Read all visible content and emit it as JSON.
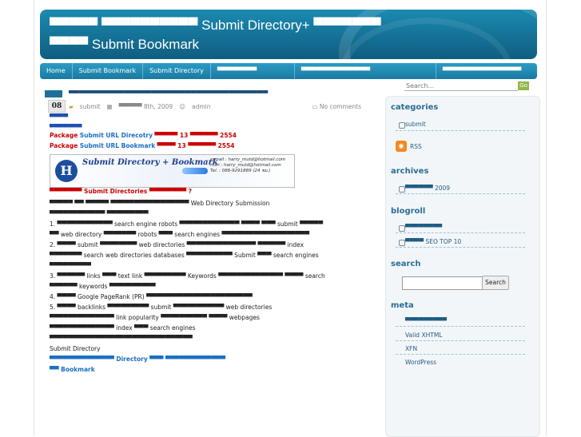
{
  "header": {
    "title_line1": "▀▀▀▀▀ ▀▀▀▀▀▀▀▀▀▀ Submit Directory+ ▀▀▀▀▀▀▀",
    "title_line2": "▀▀▀▀ Submit Bookmark"
  },
  "nav": {
    "items": [
      "Home",
      "Submit Bookmark",
      "Submit Directory",
      "▀▀▀▀▀▀▀▀",
      "▀▀▀▀▀▀▀▀▀▀▀▀▀▀",
      "▀▀▀▀▀▀▀▀▀▀▀▀▀▀▀▀"
    ]
  },
  "search": {
    "placeholder": "Search...",
    "go_label": "Go"
  },
  "post": {
    "date_day": "08",
    "title": "▀▀▀▀▀▀▀▀▀▀▀▀▀▀▀▀▀▀▀▀▀▀▀▀▀▀▀▀▀▀▀▀▀▀▀▀",
    "category": "submit",
    "date_text": "▀▀▀▀▀ 8th, 2009",
    "author": "admin",
    "comments": "No comments",
    "line_a": "▀▀▀▀",
    "line_b": "▀▀▀▀▀▀▀",
    "pkg1_a": "Package",
    "pkg1_b": "Submit URL Direcotry",
    "pkg1_c": "▀▀▀▀▀ 13 ▀▀▀▀▀▀ 2554",
    "pkg2_a": "Package",
    "pkg2_b": "Submit URL Bookmark",
    "pkg2_c": "▀▀▀▀ 13 ▀▀▀▀▀▀ 2554",
    "banner_logo": "H",
    "banner_title": "Submit Directory + Bookmark",
    "banner_contact_1": "e-mail : harry_mutd@hotmail.com",
    "banner_contact_2": "msn : harry_mutd@hotmail.com",
    "banner_contact_3": "Tel. : 086-9291889 (24 ชม.)",
    "after_banner": "▀▀▀▀▀▀▀ Submit Directories ▀▀▀▀▀▀▀▀ ?",
    "p1": "▀▀▀▀▀ ▀▀ ▀▀▀▀▀ ▀▀▀▀▀▀▀▀▀▀▀▀▀▀▀▀▀ Web Directory Submission ▀▀▀▀▀▀▀▀▀▀▀▀ ▀▀▀▀▀▀▀▀▀",
    "p2": "1. ▀▀▀▀▀▀▀▀▀▀▀▀ search engine robots ▀▀▀▀▀▀▀▀▀▀▀▀▀ ▀▀▀▀ ▀▀▀ submit ▀▀▀▀▀ ▀▀ web directory ▀▀▀▀▀▀▀ robots ▀▀▀ search engines ▀▀▀▀▀▀▀▀▀▀▀▀▀▀▀▀▀▀▀",
    "p3": "2. ▀▀▀▀ submit ▀▀▀▀▀▀▀▀ web directories ▀▀▀▀▀▀▀▀▀▀▀▀▀▀▀ ▀▀▀▀▀▀ index ▀▀▀▀▀▀▀ search web directories databases ▀▀▀▀▀▀▀▀▀▀ Submit ▀▀▀ search engines ▀▀▀▀▀▀▀▀▀",
    "p4": "3. ▀▀▀▀▀▀ links ▀▀▀ text link ▀▀▀▀▀▀▀▀▀ Keywords ▀▀▀▀▀▀▀▀▀▀▀▀▀▀ ▀▀▀▀ search ▀▀▀▀▀▀ keywords ▀▀▀▀▀▀▀▀▀▀",
    "p5": "4. ▀▀▀▀ Google PageRank (PR) ▀▀▀▀▀▀▀▀▀▀▀▀▀▀▀▀▀▀▀▀▀▀▀",
    "p6": "5. ▀▀▀▀ backlinks ▀▀▀▀▀▀▀▀▀ submit ▀▀▀▀▀▀▀▀▀▀▀ web directories ▀▀▀▀▀▀▀▀▀▀▀▀▀▀ link popularity ▀▀▀▀▀▀▀▀▀▀ ▀▀▀▀ webpages ▀▀▀▀▀▀▀▀▀▀▀▀▀▀ index ▀▀▀ search engines ▀▀▀▀▀▀▀▀▀▀▀▀▀▀▀▀▀▀▀▀▀▀▀▀▀▀▀▀▀▀▀",
    "p7": "Submit Directory",
    "link1_a": "▀▀▀▀▀▀▀▀▀▀▀▀▀▀ Directory",
    "link1_b": "▀▀▀ ▀▀▀▀▀▀▀▀▀▀▀▀▀",
    "link2": "▀▀ Bookmark"
  },
  "sidebar": {
    "categories_h": "categories",
    "cat_submit": "submit",
    "rss": "RSS",
    "archives_h": "archives",
    "archive_item": "▀▀▀▀▀▀ 2009",
    "blogroll_h": "blogroll",
    "blogroll_1": "▀▀▀▀▀▀▀▀",
    "blogroll_2": "▀▀▀▀ SEO TOP 10",
    "search_h": "search",
    "search_btn": "Search",
    "meta_h": "meta",
    "meta_1": "▀▀▀▀▀▀▀▀▀",
    "meta_2": "Valid XHTML",
    "meta_3": "XFN",
    "meta_4": "WordPress"
  },
  "colors": {
    "header_blue": "#146f94",
    "accent_red": "#cc0000",
    "link_blue": "#1a6fc2",
    "go_green": "#8fb84a",
    "rss_orange": "#f18a22"
  }
}
